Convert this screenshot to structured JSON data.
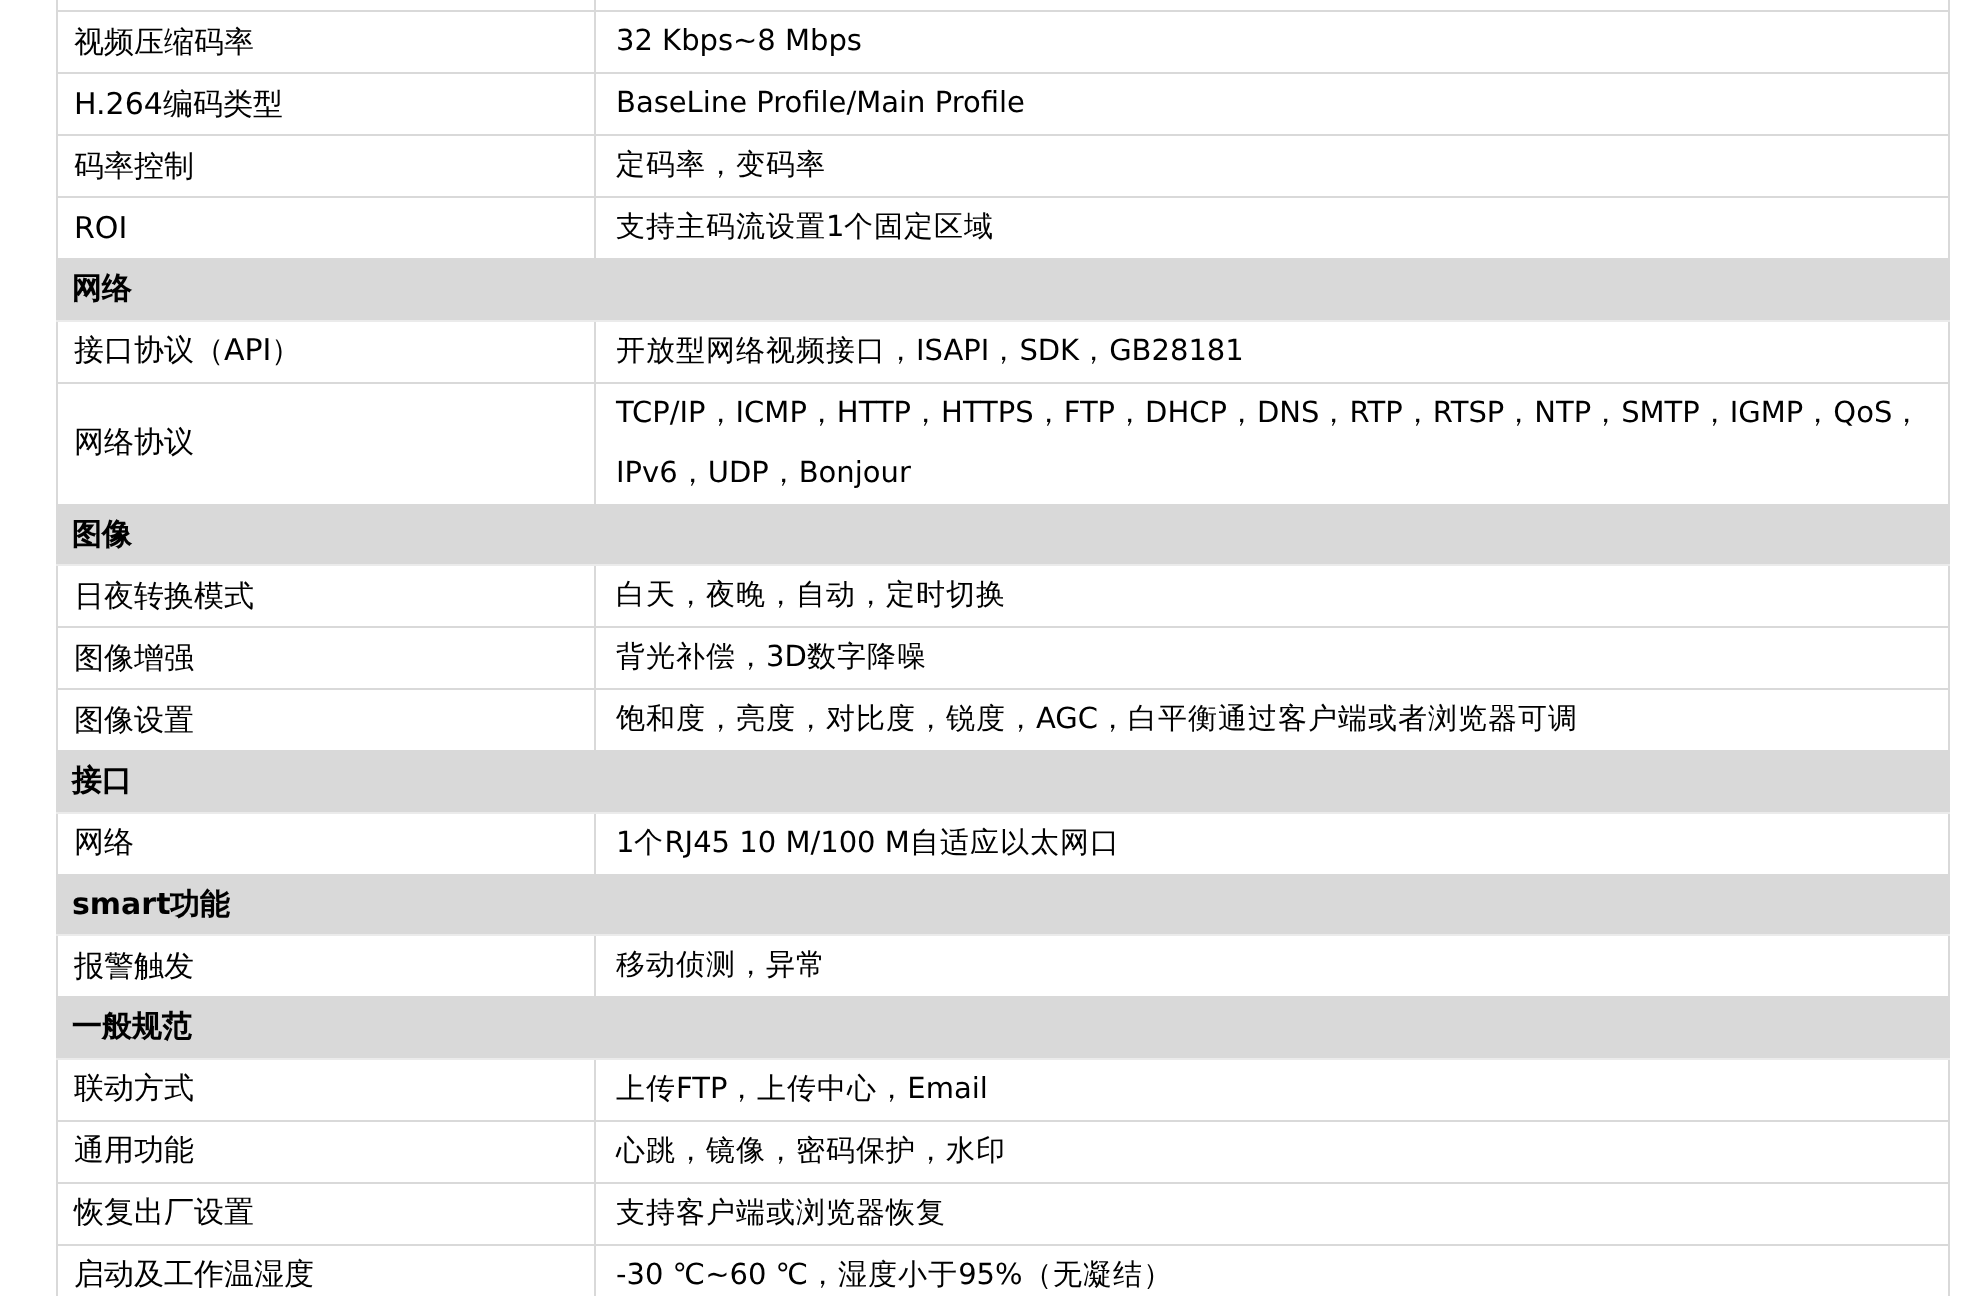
{
  "rows": [
    {
      "kind": "item",
      "label": "视频压缩码率",
      "value": "32 Kbps~8 Mbps"
    },
    {
      "kind": "item",
      "label": "H.264编码类型",
      "value": "BaseLine Profile/Main Profile"
    },
    {
      "kind": "item",
      "label": "码率控制",
      "value": "定码率，变码率"
    },
    {
      "kind": "item",
      "label": "ROI",
      "value": "支持主码流设置1个固定区域"
    },
    {
      "kind": "section",
      "label": "网络"
    },
    {
      "kind": "item",
      "label": "接口协议（API）",
      "value": "开放型网络视频接口，ISAPI，SDK，GB28181"
    },
    {
      "kind": "item",
      "label": "网络协议",
      "value": "TCP/IP，ICMP，HTTP，HTTPS，FTP，DHCP，DNS，RTP，RTSP，NTP，SMTP，IGMP，QoS，IPv6，UDP，Bonjour"
    },
    {
      "kind": "section",
      "label": "图像"
    },
    {
      "kind": "item",
      "label": "日夜转换模式",
      "value": "白天，夜晚，自动，定时切换"
    },
    {
      "kind": "item",
      "label": "图像增强",
      "value": "背光补偿，3D数字降噪"
    },
    {
      "kind": "item",
      "label": "图像设置",
      "value": "饱和度，亮度，对比度，锐度，AGC，白平衡通过客户端或者浏览器可调"
    },
    {
      "kind": "section",
      "label": "接口"
    },
    {
      "kind": "item",
      "label": "网络",
      "value": "1个RJ45 10 M/100 M自适应以太网口"
    },
    {
      "kind": "section",
      "label": "smart功能"
    },
    {
      "kind": "item",
      "label": "报警触发",
      "value": "移动侦测，异常"
    },
    {
      "kind": "section",
      "label": "一般规范"
    },
    {
      "kind": "item",
      "label": "联动方式",
      "value": "上传FTP，上传中心，Email"
    },
    {
      "kind": "item",
      "label": "通用功能",
      "value": "心跳，镜像，密码保护，水印"
    },
    {
      "kind": "item",
      "label": "恢复出厂设置",
      "value": "支持客户端或浏览器恢复"
    },
    {
      "kind": "item",
      "label": "启动及工作温湿度",
      "value": "-30 ℃~60 ℃，湿度小于95%（无凝结）"
    }
  ]
}
